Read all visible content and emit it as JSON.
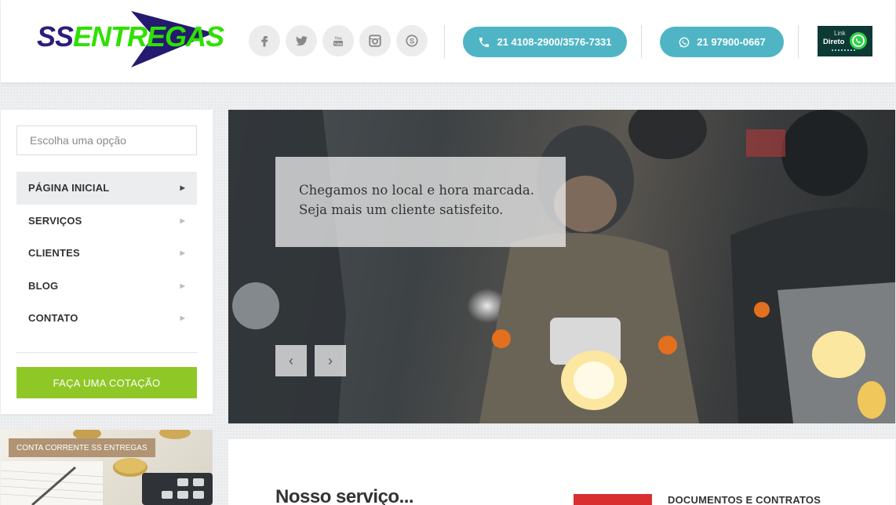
{
  "header": {
    "logo_ss": "SS",
    "logo_entregas": "ENTREGAS",
    "social": [
      {
        "icon": "facebook-icon"
      },
      {
        "icon": "twitter-icon"
      },
      {
        "icon": "youtube-icon",
        "label": "You Tube"
      },
      {
        "icon": "instagram-icon"
      },
      {
        "icon": "skype-icon"
      }
    ],
    "phone_label": "21 4108-2900/3576-7331",
    "whatsapp_label": "21 97900-0667",
    "badge_line1": "Link",
    "badge_line2": "Direto"
  },
  "sidebar": {
    "select_placeholder": "Escolha uma opção",
    "items": [
      {
        "label": "PÁGINA INICIAL",
        "active": true
      },
      {
        "label": "SERVIÇOS"
      },
      {
        "label": "CLIENTES"
      },
      {
        "label": "BLOG"
      },
      {
        "label": "CONTATO"
      }
    ],
    "quote_button": "FAÇA UMA COTAÇÃO"
  },
  "promo": {
    "tag": "CONTA CORRENTE SS ENTREGAS"
  },
  "hero": {
    "caption_line1": "Chegamos no local e hora marcada.",
    "caption_line2": "Seja mais um cliente satisfeito.",
    "prev_symbol": "‹",
    "next_symbol": "›"
  },
  "content": {
    "title": "Nosso serviço...",
    "item_title": "DOCUMENTOS E CONTRATOS"
  },
  "colors": {
    "accent_teal": "#4fb5c5",
    "accent_green": "#8fc727",
    "logo_navy": "#2b1e7a",
    "logo_green": "#2fe000"
  }
}
